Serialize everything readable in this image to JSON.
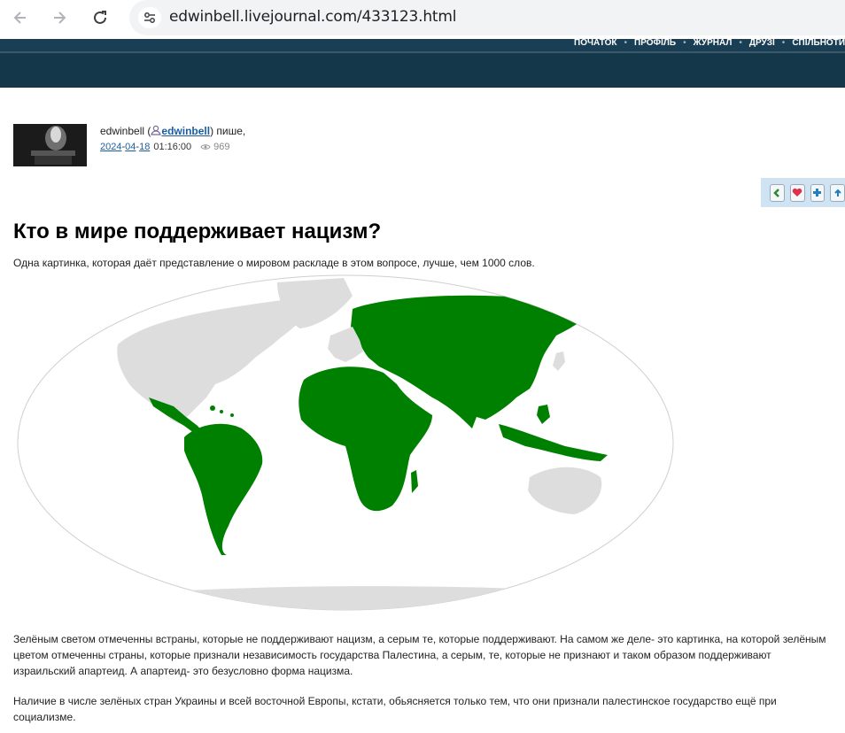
{
  "browser": {
    "url": "edwinbell.livejournal.com/433123.html",
    "back_icon": "arrow-left-icon",
    "forward_icon": "arrow-right-icon",
    "reload_icon": "reload-icon",
    "site_info_icon": "tune-icon"
  },
  "site_nav": {
    "items": [
      "ПОЧАТОК",
      "ПРОФІЛЬ",
      "ЖУРНАЛ",
      "ДРУЗІ",
      "СПІЛЬНОТИ"
    ]
  },
  "post": {
    "author_name": "edwinbell",
    "author_user": "edwinbell",
    "author_suffix": ") пише,",
    "date_year": "2024",
    "date_month": "04",
    "date_day": "18",
    "time": "01:16:00",
    "views": "969",
    "title": "Кто в мире поддерживает нацизм?",
    "intro": "Одна картинка, которая даёт представление о мировом раскладе в этом вопросе, лучше, чем 1000 слов.",
    "para1": "Зелёным светом отмеченны встраны, которые не поддерживают нацизм, а серым те, которые поддерживают. На самом же деле- это картинка, на которой зелёным цветом отмеченны страны, которые признали независимость государства Палестина, а серым, те, которые не признают и таком образом поддерживают израильский апартеид. А апартеид- это безусловно форма нацизма.",
    "para2": "Наличие в числе зелёных стран Украины и всей восточной Европы, кстати, обьясняется только тем, что они признали палестинское государство ещё при социализме."
  },
  "share": {
    "icons": [
      "back-arrow-icon",
      "heart-icon",
      "plus-icon",
      "share-icon"
    ]
  },
  "map": {
    "green": "#008000",
    "gray": "#dddddd"
  }
}
